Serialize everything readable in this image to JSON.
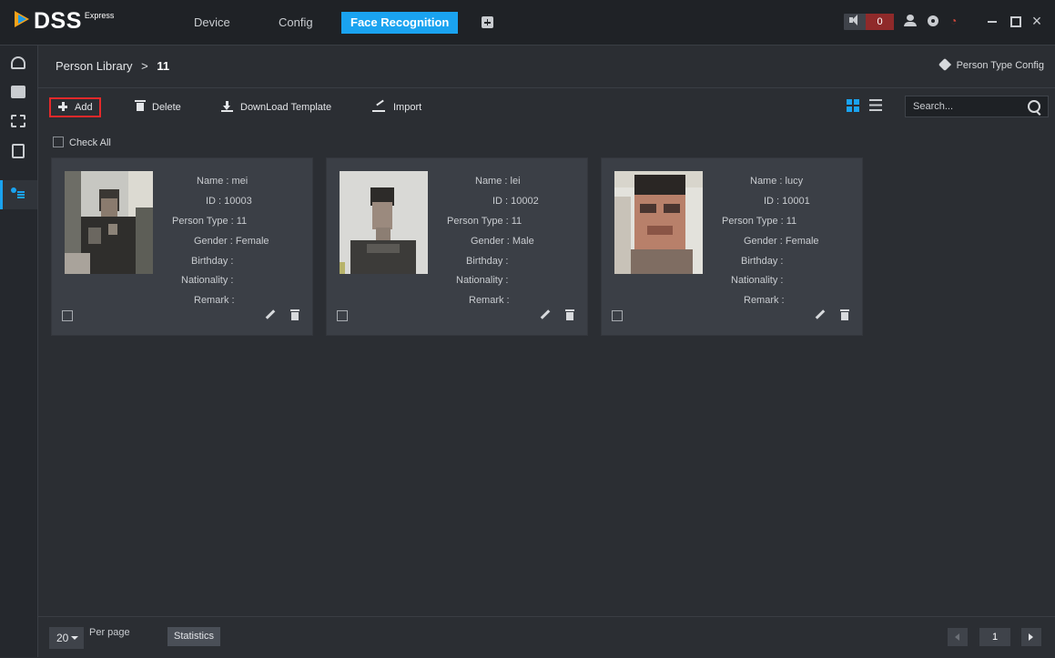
{
  "app": {
    "logo_text": "DSS",
    "logo_sup": "Express"
  },
  "nav": {
    "items": [
      {
        "label": "Device"
      },
      {
        "label": "Config"
      },
      {
        "label": "Face Recognition"
      }
    ]
  },
  "titlebar": {
    "alarm_count": "0",
    "accent": "#1aa3f0",
    "alarm_color": "#8f2a2a"
  },
  "sidebar": {
    "icons": [
      "camera-icon",
      "image-search-icon",
      "face-frame-icon",
      "document-icon",
      "person-library-icon"
    ],
    "active": "person-library-icon"
  },
  "breadcrumb": {
    "root": "Person Library",
    "separator": ">",
    "current": "11"
  },
  "person_type_config": "Person Type Config",
  "toolbar": {
    "add": "Add",
    "delete": "Delete",
    "download": "DownLoad Template",
    "import": "Import"
  },
  "search": {
    "placeholder": "Search..."
  },
  "check_all": "Check All",
  "persons": [
    {
      "name": "Name : mei",
      "id": "ID : 10003",
      "type": "Person Type : 11",
      "gender": "Gender : Female",
      "birthday": "Birthday :",
      "nationality": "Nationality :",
      "remark": "Remark :"
    },
    {
      "name": "Name : lei",
      "id": "ID : 10002",
      "type": "Person Type : 11",
      "gender": "Gender : Male",
      "birthday": "Birthday :",
      "nationality": "Nationality :",
      "remark": "Remark :"
    },
    {
      "name": "Name : lucy",
      "id": "ID : 10001",
      "type": "Person Type : 11",
      "gender": "Gender : Female",
      "birthday": "Birthday :",
      "nationality": "Nationality :",
      "remark": "Remark :"
    }
  ],
  "footer": {
    "per_page_value": "20",
    "per_page_label": "Per page",
    "statistics": "Statistics",
    "current_page": "1"
  }
}
